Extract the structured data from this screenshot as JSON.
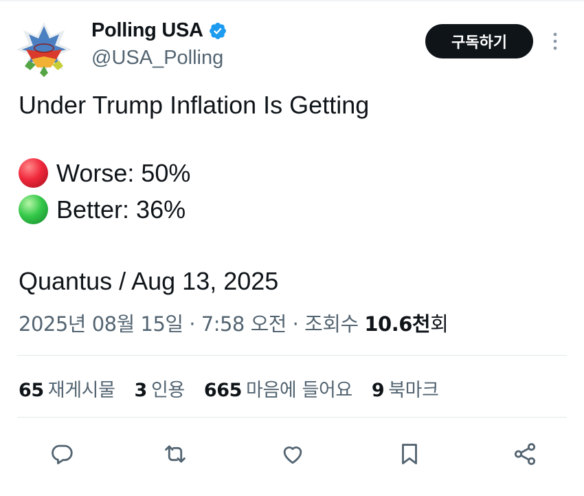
{
  "header": {
    "display_name": "Polling USA",
    "handle": "@USA_Polling",
    "subscribe_label": "구독하기",
    "verified_color": "#1d9bf0"
  },
  "tweet": {
    "lines": [
      "Under Trump Inflation Is Getting",
      "Worse: 50%",
      "Better: 36%",
      "Quantus / Aug 13, 2025"
    ],
    "poll_icons": [
      "red-circle-emoji",
      "green-circle-emoji"
    ]
  },
  "meta": {
    "timestamp": "2025년 08월 15일 · 7:58 오전 · 조회수 ",
    "views_count": "10.6",
    "views_unit": "천",
    "views_suffix": "회"
  },
  "stats": [
    {
      "count": "65",
      "label": "재게시물"
    },
    {
      "count": "3",
      "label": "인용"
    },
    {
      "count": "665",
      "label": "마음에 들어요"
    },
    {
      "count": "9",
      "label": "북마크"
    }
  ],
  "actions": [
    "reply-icon",
    "repost-icon",
    "like-icon",
    "bookmark-icon",
    "share-icon"
  ],
  "colors": {
    "text": "#0f1419",
    "secondary": "#536471",
    "button_bg": "#0f1419",
    "divider": "#e1e6e9"
  }
}
